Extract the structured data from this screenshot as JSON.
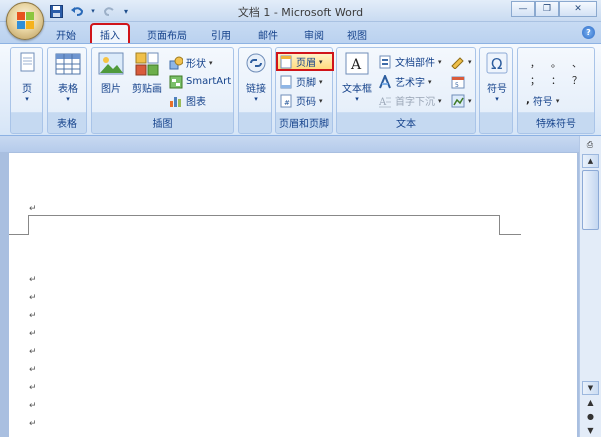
{
  "window": {
    "title": "文档 1 - Microsoft Word"
  },
  "qat": {
    "save_icon": "save-icon",
    "undo_icon": "undo-icon",
    "redo_icon": "redo-icon",
    "customize_icon": "customize-qat-icon"
  },
  "tabs": [
    {
      "label": "开始"
    },
    {
      "label": "插入",
      "active": true
    },
    {
      "label": "页面布局"
    },
    {
      "label": "引用"
    },
    {
      "label": "邮件"
    },
    {
      "label": "审阅"
    },
    {
      "label": "视图"
    }
  ],
  "ribbon": {
    "pages_group": {
      "button": "页"
    },
    "tables_group": {
      "label": "表格",
      "button": "表格"
    },
    "illustrations_group": {
      "label": "插图",
      "picture": "图片",
      "clipart": "剪贴画",
      "shapes": "形状",
      "smartart": "SmartArt",
      "chart": "图表"
    },
    "links_group": {
      "button": "链接"
    },
    "header_footer_group": {
      "label": "页眉和页脚",
      "header": "页眉",
      "footer": "页脚",
      "page_number": "页码"
    },
    "text_group": {
      "label": "文本",
      "textbox": "文本框",
      "quickparts": "文档部件",
      "wordart": "艺术字",
      "dropcap": "首字下沉"
    },
    "symbols_group": {
      "button": "符号"
    },
    "special_symbols_group": {
      "label": "特殊符号",
      "symbol_button": "符号",
      "glyphs": [
        "，",
        "。",
        "、",
        "；",
        "：",
        "？"
      ]
    }
  },
  "colors": {
    "highlight": "#d0141a",
    "ribbon_text": "#15428b"
  }
}
